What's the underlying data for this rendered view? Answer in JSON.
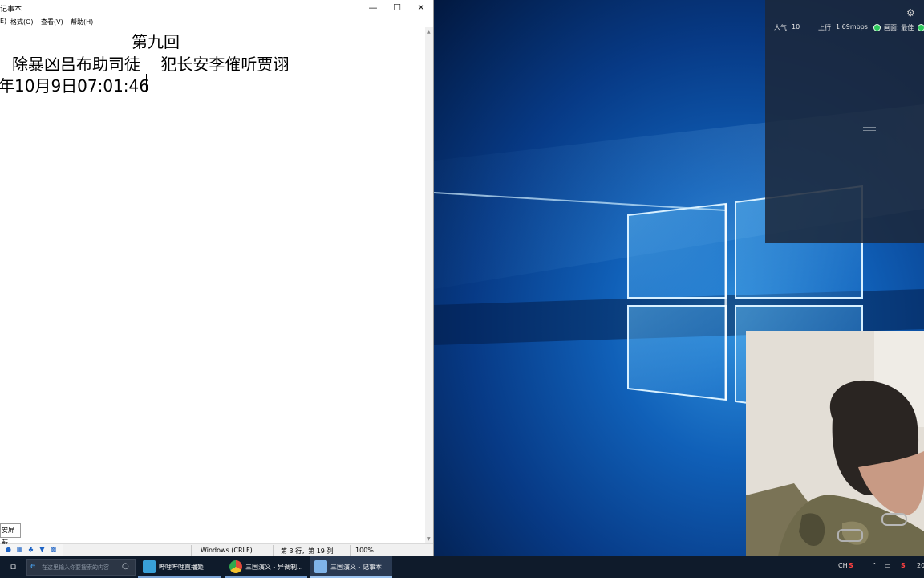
{
  "notepad": {
    "title": "记事本",
    "menu": [
      "E)",
      "格式(O)",
      "查看(V)",
      "帮助(H)"
    ],
    "lines": [
      "第九回",
      "除暴凶吕布助司徒    犯长安李傕听贾诩",
      "年10月9日07:01:46"
    ],
    "status": {
      "line_ending": "Windows (CRLF)",
      "position": "第 3 行，第 19 列",
      "zoom": "100%"
    },
    "window_buttons": {
      "minimize": "—",
      "maximize": "☐",
      "close": "✕"
    }
  },
  "ime": {
    "label": "安屏蔽",
    "icons": [
      "mic-icon",
      "keyboard-icon",
      "skin-icon",
      "shirt-icon",
      "grid-icon"
    ]
  },
  "stream_panel": {
    "popularity_label": "人气",
    "popularity_value": "10",
    "upload_label": "上行",
    "upload_value": "1.69mbps",
    "quality_label": "画面: 最佳"
  },
  "taskbar": {
    "search_placeholder": "在这里输入你要搜索的内容",
    "apps": [
      {
        "label": "哔哩哔哩直播姬",
        "icon_color": "#39a0d8",
        "active": false
      },
      {
        "label": "三国演义 - 异调制...",
        "icon_color": "#e04a3a",
        "active": false
      },
      {
        "label": "三国演义 - 记事本",
        "icon_color": "#7fb3e8",
        "active": true
      }
    ],
    "tray": {
      "ime_mode": "CH",
      "clock": "20"
    }
  },
  "colors": {
    "taskbar_bg": "#0f1b2b",
    "accent_green": "#2ec95c",
    "desktop_blue": "#1060b8"
  }
}
